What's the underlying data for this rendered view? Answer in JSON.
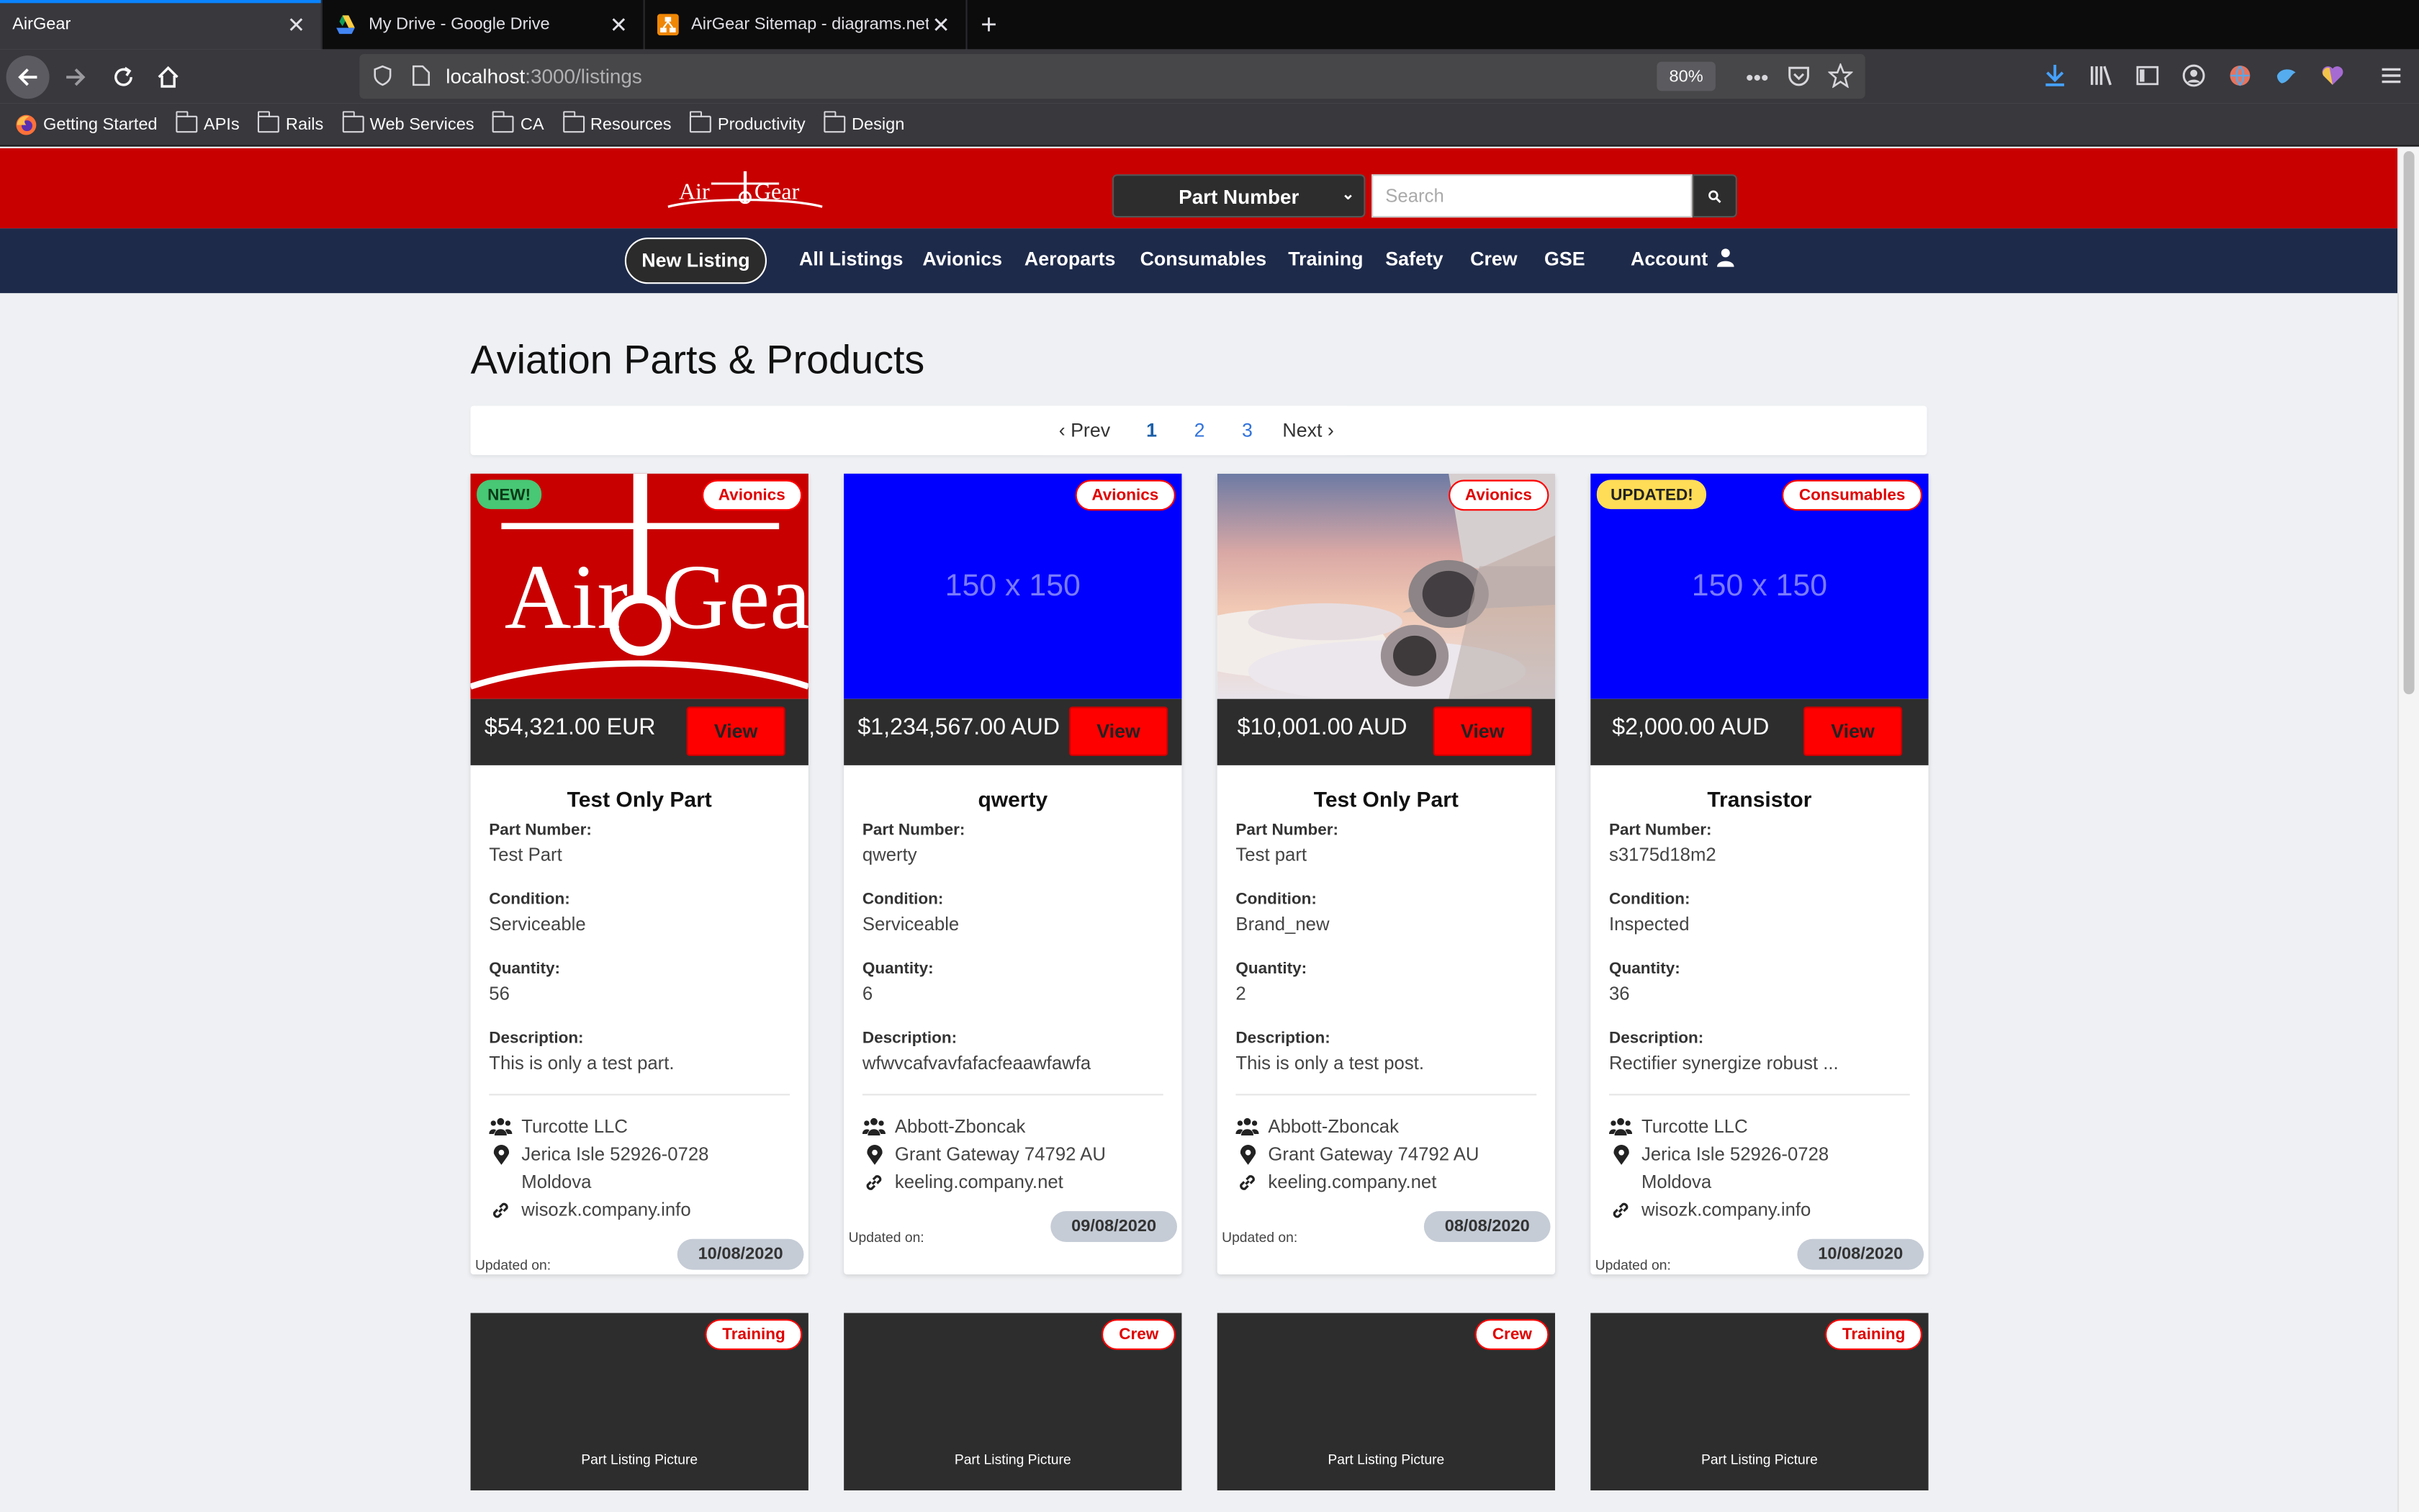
{
  "browser": {
    "tabs": [
      {
        "title": "AirGear",
        "active": true
      },
      {
        "title": "My Drive - Google Drive",
        "active": false
      },
      {
        "title": "AirGear Sitemap - diagrams.net",
        "active": false
      }
    ],
    "url_host": "localhost",
    "url_path": ":3000/listings",
    "zoom": "80%",
    "bookmarks": [
      "Getting Started",
      "APIs",
      "Rails",
      "Web Services",
      "CA",
      "Resources",
      "Productivity",
      "Design"
    ]
  },
  "header": {
    "logo_text": "AirGear",
    "search_type": "Part Number",
    "search_placeholder": "Search"
  },
  "nav": {
    "new_listing": "New Listing",
    "links": [
      "All Listings",
      "Avionics",
      "Aeroparts",
      "Consumables",
      "Training",
      "Safety",
      "Crew",
      "GSE"
    ],
    "account": "Account"
  },
  "page": {
    "title": "Aviation Parts & Products",
    "pagination": {
      "prev": "‹ Prev",
      "pages": [
        "1",
        "2",
        "3"
      ],
      "current": "1",
      "next": "Next ›"
    }
  },
  "labels": {
    "part_number": "Part Number:",
    "condition": "Condition:",
    "quantity": "Quantity:",
    "description": "Description:",
    "updated_on": "Updated on:",
    "view": "View",
    "placeholder_150": "150 x 150",
    "listing_picture": "Part Listing Picture"
  },
  "listings": [
    {
      "badge": "NEW!",
      "category": "Avionics",
      "image": "airgear-logo",
      "price": "$54,321.00 EUR",
      "title": "Test Only Part",
      "part_number": "Test Part",
      "condition": "Serviceable",
      "quantity": "56",
      "description": "This is only a test part.",
      "company": "Turcotte LLC",
      "address1": "Jerica Isle 52926-0728",
      "address2": "Moldova",
      "website": "wisozk.company.info",
      "updated": "10/08/2020"
    },
    {
      "badge": "",
      "category": "Avionics",
      "image": "placeholder",
      "price": "$1,234,567.00 AUD",
      "title": "qwerty",
      "part_number": "qwerty",
      "condition": "Serviceable",
      "quantity": "6",
      "description": "wfwvcafvavfafacfeaawfawfa",
      "company": "Abbott-Zboncak",
      "address1": "Grant Gateway 74792 AU",
      "address2": "",
      "website": "keeling.company.net",
      "updated": "09/08/2020"
    },
    {
      "badge": "",
      "category": "Avionics",
      "image": "aircraft-photo",
      "price": "$10,001.00 AUD",
      "title": "Test Only Part",
      "part_number": "Test part",
      "condition": "Brand_new",
      "quantity": "2",
      "description": "This is only a test post.",
      "company": "Abbott-Zboncak",
      "address1": "Grant Gateway 74792 AU",
      "address2": "",
      "website": "keeling.company.net",
      "updated": "08/08/2020"
    },
    {
      "badge": "UPDATED!",
      "category": "Consumables",
      "image": "placeholder",
      "price": "$2,000.00 AUD",
      "title": "Transistor",
      "part_number": "s3175d18m2",
      "condition": "Inspected",
      "quantity": "36",
      "description": "Rectifier synergize robust ...",
      "company": "Turcotte LLC",
      "address1": "Jerica Isle 52926-0728",
      "address2": "Moldova",
      "website": "wisozk.company.info",
      "updated": "10/08/2020"
    }
  ],
  "listings_row2": [
    {
      "category": "Training"
    },
    {
      "category": "Crew"
    },
    {
      "category": "Crew"
    },
    {
      "category": "Training"
    }
  ],
  "colors": {
    "brand_red": "#c80000",
    "nav_navy": "#1e2a4a",
    "button_red": "#ff0000",
    "placeholder_blue": "#0000ff"
  }
}
